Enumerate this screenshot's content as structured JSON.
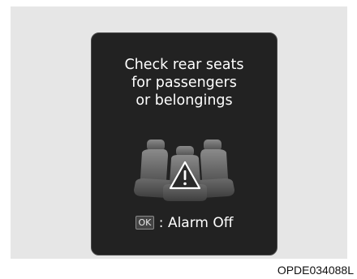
{
  "display": {
    "message_lines": [
      "Check rear seats",
      "for passengers",
      "or belongings"
    ],
    "ok_key": "OK",
    "separator": ":",
    "action_label": "Alarm Off",
    "icon": "rear-seats-warning-icon"
  },
  "caption": "OPDE034088L",
  "colors": {
    "screen_background": "#222222",
    "page_background": "#e6e6e6",
    "text": "#ffffff",
    "seat_gray": "#7a7a7a"
  }
}
